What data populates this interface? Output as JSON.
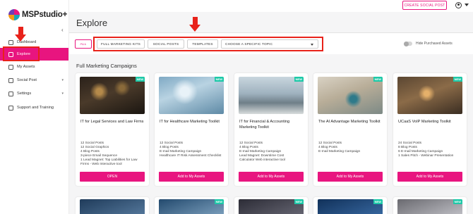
{
  "header": {
    "create_label": "CREATE SOCIAL POST"
  },
  "sidebar": {
    "logo_text": "MSPstudio+",
    "items": [
      {
        "label": "Dashboard",
        "icon": "home-icon",
        "active": false
      },
      {
        "label": "Explore",
        "icon": "grid-icon",
        "active": true
      },
      {
        "label": "My Assets",
        "icon": "folder-icon",
        "active": false
      },
      {
        "label": "Social Post",
        "icon": "share-icon",
        "active": false,
        "has_arrow": true
      },
      {
        "label": "Settings",
        "icon": "gear-icon",
        "active": false,
        "has_arrow": true
      },
      {
        "label": "Support and Training",
        "icon": "help-icon",
        "active": false
      }
    ]
  },
  "main": {
    "title": "Explore",
    "filters": {
      "all": "ALL",
      "kits": "FULL MARKETING KITS",
      "social": "SOCIAL POSTS",
      "templates": "TEMPLATES",
      "topic": "CHOOSE A SPECIFIC TOPIC",
      "hide_label": "Hide Purchased Assets"
    },
    "section_title": "Full Marketing Campaigns",
    "cards": [
      {
        "badge": "NEW",
        "title": "IT for Legal Services and Law Firms",
        "desc": [
          "12 Social Posts",
          "12 Social Graphics",
          "4 Blog Posts",
          "3-piece Email Sequence",
          "1 Lead Magnet: Top Liabilities for Law",
          "Firms - Web Interactive tool"
        ],
        "button": "OPEN"
      },
      {
        "badge": "NEW",
        "title": "IT for Healthcare Marketing Toolkit",
        "desc": [
          "12 Social Posts",
          "4 Blog Posts",
          "E-mail Marketing Campaign",
          "Healthcare IT Risk Assessment Checklist"
        ],
        "button": "Add to My Assets"
      },
      {
        "badge": "NEW",
        "title": "IT for Financial & Accounting Marketing Toolkit",
        "desc": [
          "12 Social Posts",
          "4 Blog Posts",
          "E-mail Marketing Campaign",
          "Lead Magnet: Downtime Cost",
          "Calculator Web interactive tool"
        ],
        "button": "Add to My Assets"
      },
      {
        "badge": "NEW",
        "title": "The AI Advantage Marketing Toolkit",
        "desc": [
          "12 Social Posts",
          "4 Blog Posts",
          "E-mail Marketing Campaign"
        ],
        "button": "Add to My Assets"
      },
      {
        "badge": "NEW",
        "title": "UCaaS VoIP Marketing Toolkit",
        "desc": [
          "24 Social Posts",
          "8 Blog Posts",
          "6 E-mail Marketing Campaign",
          "1 Sales Pitch - Webinar Presentation"
        ],
        "button": "Add to My Assets"
      }
    ]
  },
  "colors": {
    "brand": "#e8157f",
    "badge": "#1ec9a8",
    "annotation": "#e8221a"
  }
}
